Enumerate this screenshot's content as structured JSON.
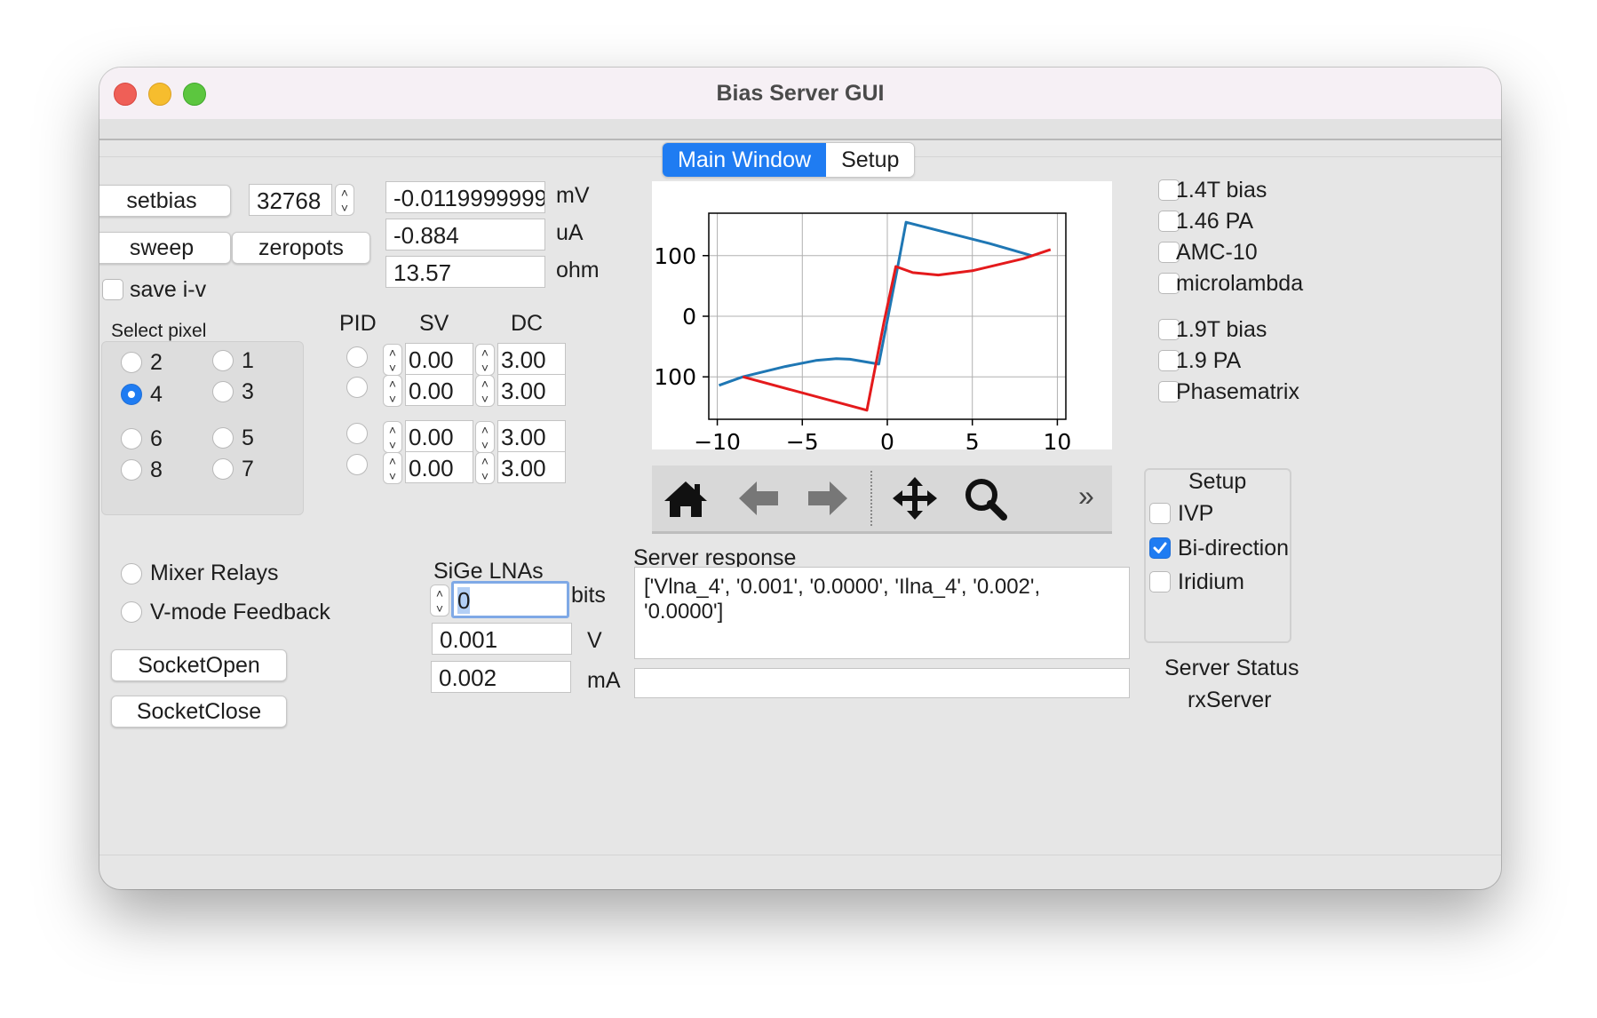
{
  "window": {
    "title": "Bias Server GUI"
  },
  "tabs": [
    {
      "label": "Main Window",
      "active": true
    },
    {
      "label": "Setup",
      "active": false
    }
  ],
  "bias": {
    "setbias_label": "setbias",
    "sweep_label": "sweep",
    "zeropots_label": "zeropots",
    "pot_value": "32768",
    "save_iv_label": "save i-v",
    "save_iv_checked": false
  },
  "readouts": [
    {
      "value": "-0.0119999999",
      "unit": "mV"
    },
    {
      "value": "-0.884",
      "unit": "uA"
    },
    {
      "value": "13.57",
      "unit": "ohm"
    }
  ],
  "pixel": {
    "label": "Select pixel",
    "options": [
      {
        "label": "2",
        "selected": false
      },
      {
        "label": "1",
        "selected": false
      },
      {
        "label": "4",
        "selected": true
      },
      {
        "label": "3",
        "selected": false
      },
      {
        "label": "6",
        "selected": false
      },
      {
        "label": "5",
        "selected": false
      },
      {
        "label": "8",
        "selected": false
      },
      {
        "label": "7",
        "selected": false
      }
    ]
  },
  "pid": {
    "headers": {
      "pid": "PID",
      "sv": "SV",
      "dc": "DC"
    },
    "rows": [
      {
        "sv": "0.00",
        "dc": "3.00"
      },
      {
        "sv": "0.00",
        "dc": "3.00"
      },
      {
        "sv": "0.00",
        "dc": "3.00"
      },
      {
        "sv": "0.00",
        "dc": "3.00"
      }
    ]
  },
  "options": {
    "mixer_relays": "Mixer Relays",
    "vmode_feedback": "V-mode Feedback",
    "socket_open": "SocketOpen",
    "socket_close": "SocketClose"
  },
  "lna": {
    "title": "SiGe LNAs",
    "bits_value": "0",
    "bits_unit": "bits",
    "voltage": "0.001",
    "voltage_unit": "V",
    "current": "0.002",
    "current_unit": "mA"
  },
  "server": {
    "response_label": "Server response",
    "response_line1": "['Vlna_4', '0.001', '0.0000', 'Ilna_4', '0.002',",
    "response_line2": "'0.0000']",
    "input_value": "",
    "status_label": "Server Status",
    "status_value": "rxServer"
  },
  "systems": [
    {
      "label": "1.4T bias",
      "checked": false
    },
    {
      "label": "1.46 PA",
      "checked": false
    },
    {
      "label": "AMC-10",
      "checked": false
    },
    {
      "label": "microlambda",
      "checked": false
    },
    {
      "label": "1.9T bias",
      "checked": false
    },
    {
      "label": "1.9 PA",
      "checked": false
    },
    {
      "label": "Phasematrix",
      "checked": false
    }
  ],
  "setup_group": {
    "title": "Setup",
    "items": [
      {
        "label": "IVP",
        "checked": false
      },
      {
        "label": "Bi-direction",
        "checked": true
      },
      {
        "label": "Iridium",
        "checked": false
      }
    ]
  },
  "toolbar": {
    "icons": [
      "home-icon",
      "back-arrow-icon",
      "forward-arrow-icon",
      "pan-icon",
      "zoom-icon",
      "overflow-icon"
    ],
    "overflow_label": "»"
  },
  "chart_data": {
    "type": "line",
    "title": "",
    "xlabel": "",
    "ylabel": "",
    "xlim": [
      -10.5,
      10.5
    ],
    "ylim": [
      -170,
      170
    ],
    "xticks": [
      -10,
      -5,
      0,
      5,
      10
    ],
    "xtick_labels": [
      "−10",
      "−5",
      "0",
      "5",
      "10"
    ],
    "yticks": [
      100,
      0,
      -100
    ],
    "ytick_labels": [
      "100",
      "0",
      "100"
    ],
    "grid": true,
    "series": [
      {
        "color": "#1f77b4",
        "x": [
          -9.9,
          -8.5,
          -6,
          -4.2,
          -3,
          -2.2,
          -0.5,
          0.6,
          1.1,
          6,
          8.5
        ],
        "y": [
          -114,
          -100,
          -83,
          -73,
          -70,
          -71,
          -79,
          80,
          155,
          120,
          100
        ]
      },
      {
        "color": "#e41a1c",
        "x": [
          -8.5,
          -1.2,
          -0.2,
          0.5,
          1.5,
          3,
          5,
          8,
          9.6
        ],
        "y": [
          -100,
          -155,
          -10,
          82,
          72,
          68,
          75,
          95,
          110
        ]
      }
    ]
  }
}
